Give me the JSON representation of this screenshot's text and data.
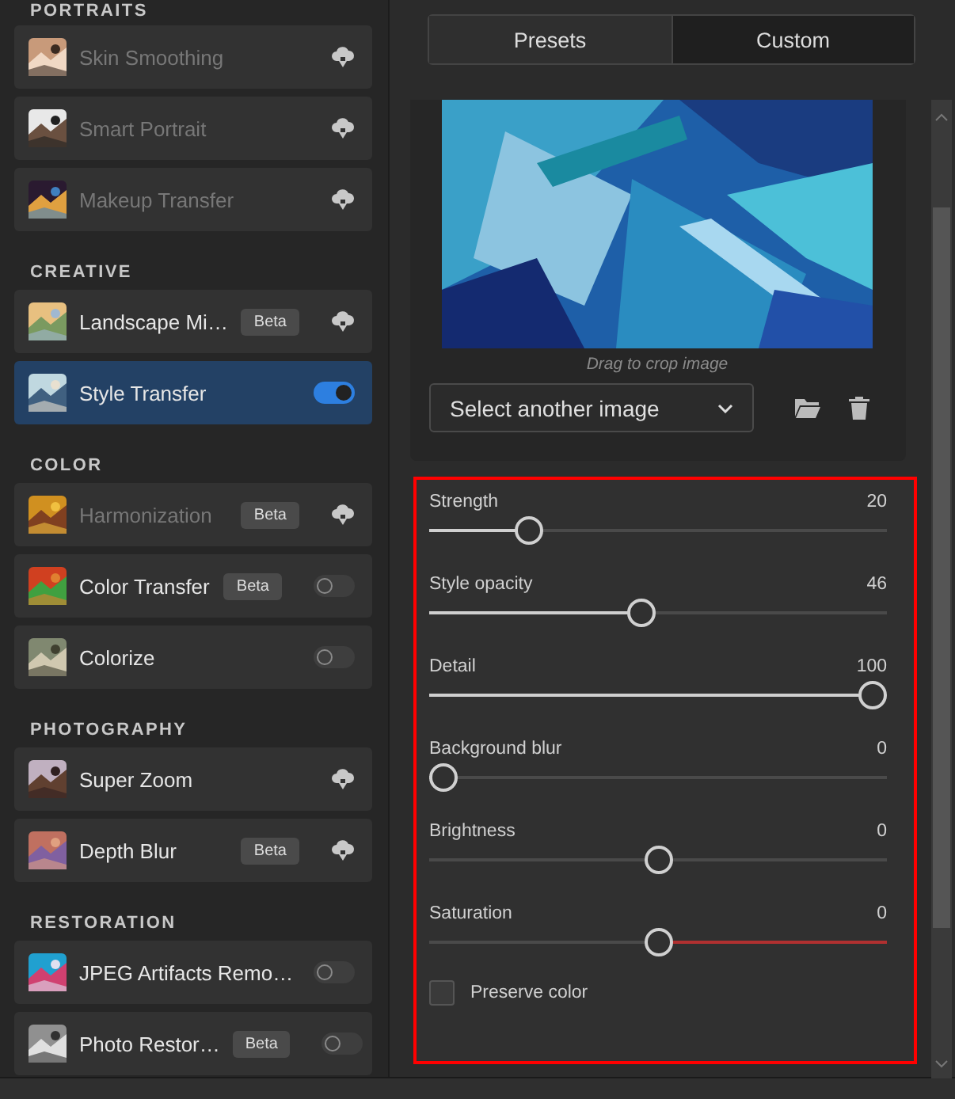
{
  "sidebar": {
    "sections": [
      {
        "title": "PORTRAITS",
        "items": [
          {
            "label": "Skin Smoothing",
            "kind": "download",
            "beta": false,
            "disabled": true,
            "selected": false
          },
          {
            "label": "Smart Portrait",
            "kind": "download",
            "beta": false,
            "disabled": true,
            "selected": false
          },
          {
            "label": "Makeup Transfer",
            "kind": "download",
            "beta": false,
            "disabled": true,
            "selected": false
          }
        ]
      },
      {
        "title": "CREATIVE",
        "items": [
          {
            "label": "Landscape Mi…",
            "kind": "download",
            "beta": true,
            "beta_label": "Beta",
            "disabled": false,
            "selected": false
          },
          {
            "label": "Style Transfer",
            "kind": "toggle",
            "on": true,
            "beta": false,
            "disabled": false,
            "selected": true
          }
        ]
      },
      {
        "title": "COLOR",
        "items": [
          {
            "label": "Harmonization",
            "kind": "download",
            "beta": true,
            "beta_label": "Beta",
            "disabled": true,
            "selected": false
          },
          {
            "label": "Color Transfer",
            "kind": "toggle",
            "on": false,
            "beta": true,
            "beta_label": "Beta",
            "disabled": false,
            "selected": false
          },
          {
            "label": "Colorize",
            "kind": "toggle",
            "on": false,
            "beta": false,
            "disabled": false,
            "selected": false
          }
        ]
      },
      {
        "title": "PHOTOGRAPHY",
        "items": [
          {
            "label": "Super Zoom",
            "kind": "download",
            "beta": false,
            "disabled": false,
            "selected": false
          },
          {
            "label": "Depth Blur",
            "kind": "download",
            "beta": true,
            "beta_label": "Beta",
            "disabled": false,
            "selected": false
          }
        ]
      },
      {
        "title": "RESTORATION",
        "items": [
          {
            "label": "JPEG Artifacts Remo…",
            "kind": "toggle",
            "on": false,
            "beta": false,
            "disabled": false,
            "selected": false
          },
          {
            "label": "Photo Restor…",
            "kind": "toggle",
            "on": false,
            "beta": true,
            "beta_label": "Beta",
            "disabled": false,
            "selected": false
          }
        ]
      }
    ]
  },
  "tabs": [
    {
      "label": "Presets",
      "selected": false
    },
    {
      "label": "Custom",
      "selected": true
    }
  ],
  "style_image": {
    "kind": "picture",
    "caption": "Drag to crop image",
    "select": "Select another image"
  },
  "sliders": [
    {
      "label": "Strength",
      "value": "20",
      "level": 0.2,
      "kind": "plain"
    },
    {
      "label": "Style opacity",
      "value": "46",
      "level": 0.46,
      "kind": "plain"
    },
    {
      "label": "Detail",
      "value": "100",
      "level": 1,
      "kind": "plain"
    },
    {
      "label": "Background blur",
      "value": "0",
      "level": 0,
      "kind": "plain"
    },
    {
      "label": "Brightness",
      "value": "0",
      "level": 0.5,
      "kind": "centered"
    },
    {
      "label": "Saturation",
      "value": "0",
      "level": 0.5,
      "kind": "saturation"
    }
  ],
  "preserve_color": {
    "label": "Preserve color",
    "checked": false
  }
}
